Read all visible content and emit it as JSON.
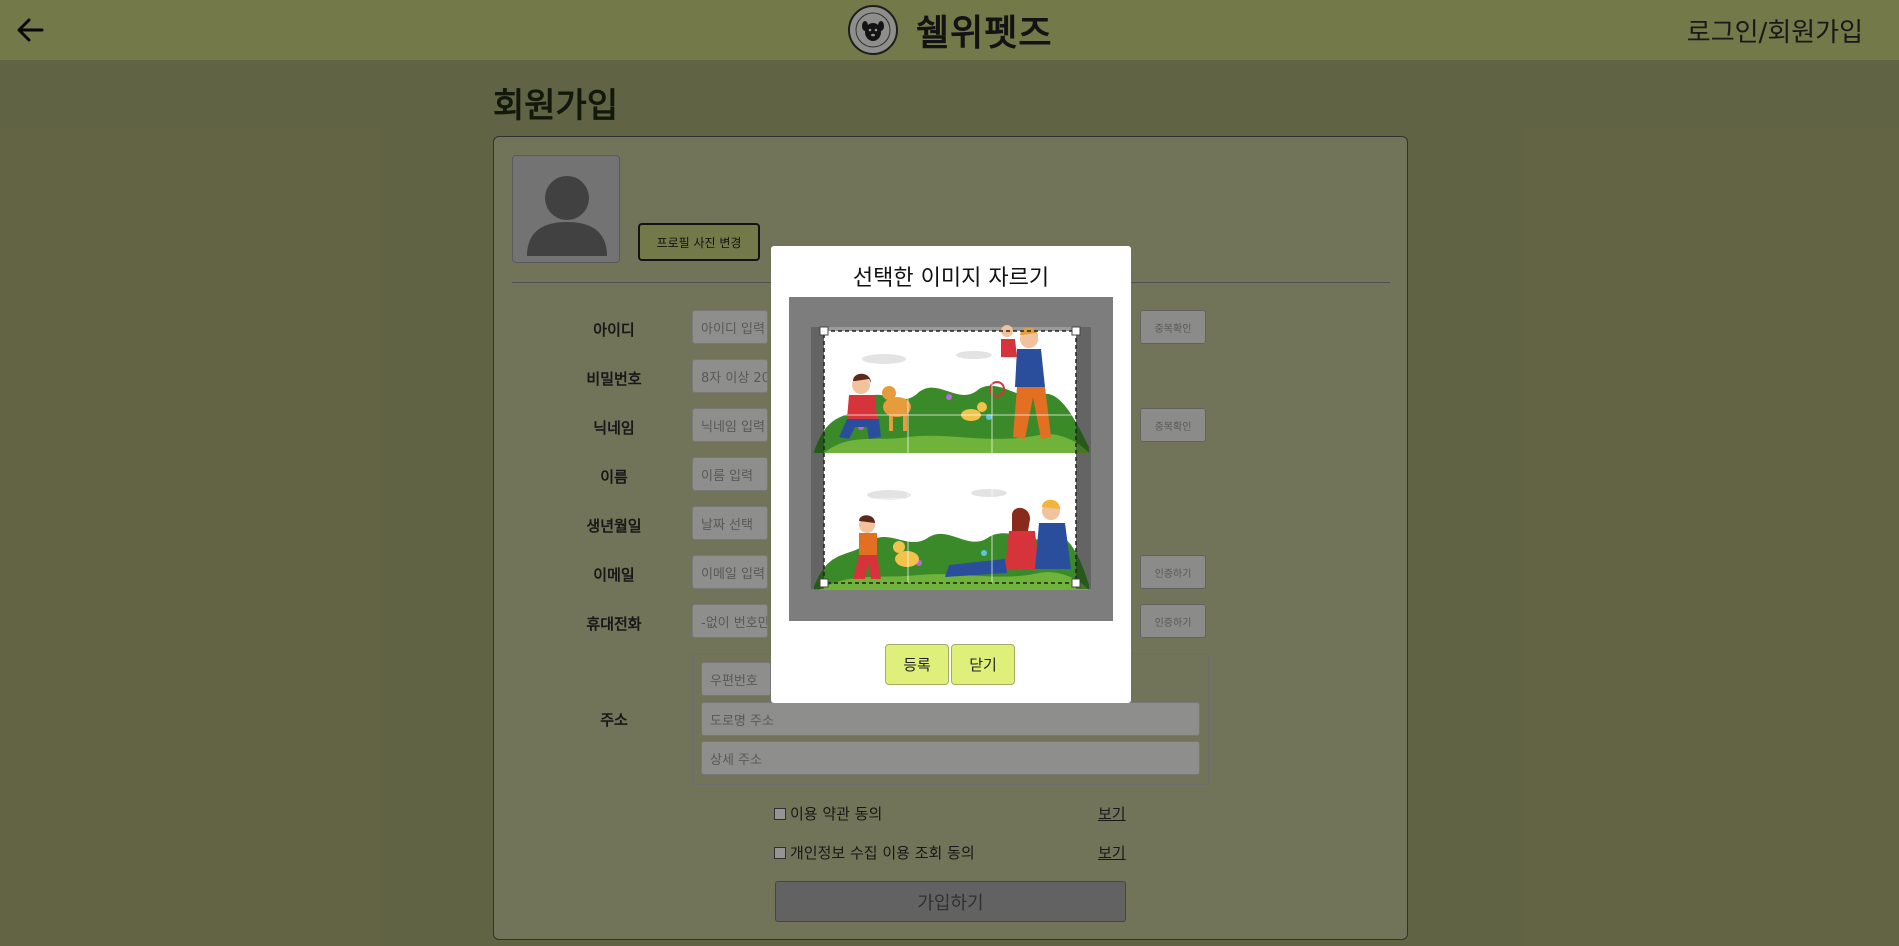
{
  "header": {
    "back_icon": "arrow-left-icon",
    "logo_icon": "dog-logo-icon",
    "brand_name": "쉘위펫즈",
    "login_link": "로그인/회원가입"
  },
  "page": {
    "title": "회원가입"
  },
  "profile": {
    "avatar_icon": "user-silhouette-icon",
    "change_button": "프로필 사진 변경"
  },
  "form": {
    "rows": [
      {
        "label": "아이디",
        "placeholder": "아이디 입력 (",
        "button": "중복확인"
      },
      {
        "label": "비밀번호",
        "placeholder": "8자 이상 20자"
      },
      {
        "label": "닉네임",
        "placeholder": "닉네임 입력",
        "button": "중복확인"
      },
      {
        "label": "이름",
        "placeholder": "이름 입력"
      },
      {
        "label": "생년월일",
        "placeholder": "날짜 선택"
      },
      {
        "label": "이메일",
        "placeholder": "이메일 입력",
        "button": "인증하기"
      },
      {
        "label": "휴대전화",
        "placeholder": "-없이 번호만",
        "button": "인증하기"
      }
    ],
    "address": {
      "label": "주소",
      "postcode_placeholder": "우편번호",
      "road_placeholder": "도로명 주소",
      "detail_placeholder": "상세 주소"
    },
    "terms": [
      {
        "label": "이용 약관 동의",
        "link": "보기"
      },
      {
        "label": "개인정보 수집 이용 조회 동의",
        "link": "보기"
      }
    ],
    "submit": "가입하기"
  },
  "modal": {
    "title": "선택한 이미지 자르기",
    "register_button": "등록",
    "close_button": "닫기"
  },
  "colors": {
    "header_bg": "#c6d17c",
    "accent_button": "#dff07a",
    "overlay": "rgba(0,0,0,0.42)"
  }
}
